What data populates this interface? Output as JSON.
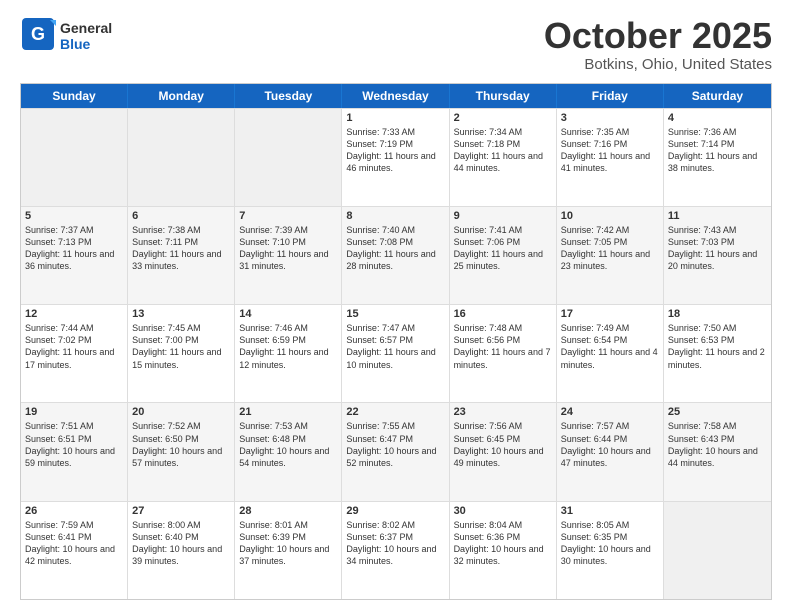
{
  "header": {
    "logo_general": "General",
    "logo_blue": "Blue",
    "month_title": "October 2025",
    "location": "Botkins, Ohio, United States"
  },
  "days_of_week": [
    "Sunday",
    "Monday",
    "Tuesday",
    "Wednesday",
    "Thursday",
    "Friday",
    "Saturday"
  ],
  "weeks": [
    [
      {
        "day": "",
        "info": ""
      },
      {
        "day": "",
        "info": ""
      },
      {
        "day": "",
        "info": ""
      },
      {
        "day": "1",
        "info": "Sunrise: 7:33 AM\nSunset: 7:19 PM\nDaylight: 11 hours\nand 46 minutes."
      },
      {
        "day": "2",
        "info": "Sunrise: 7:34 AM\nSunset: 7:18 PM\nDaylight: 11 hours\nand 44 minutes."
      },
      {
        "day": "3",
        "info": "Sunrise: 7:35 AM\nSunset: 7:16 PM\nDaylight: 11 hours\nand 41 minutes."
      },
      {
        "day": "4",
        "info": "Sunrise: 7:36 AM\nSunset: 7:14 PM\nDaylight: 11 hours\nand 38 minutes."
      }
    ],
    [
      {
        "day": "5",
        "info": "Sunrise: 7:37 AM\nSunset: 7:13 PM\nDaylight: 11 hours\nand 36 minutes."
      },
      {
        "day": "6",
        "info": "Sunrise: 7:38 AM\nSunset: 7:11 PM\nDaylight: 11 hours\nand 33 minutes."
      },
      {
        "day": "7",
        "info": "Sunrise: 7:39 AM\nSunset: 7:10 PM\nDaylight: 11 hours\nand 31 minutes."
      },
      {
        "day": "8",
        "info": "Sunrise: 7:40 AM\nSunset: 7:08 PM\nDaylight: 11 hours\nand 28 minutes."
      },
      {
        "day": "9",
        "info": "Sunrise: 7:41 AM\nSunset: 7:06 PM\nDaylight: 11 hours\nand 25 minutes."
      },
      {
        "day": "10",
        "info": "Sunrise: 7:42 AM\nSunset: 7:05 PM\nDaylight: 11 hours\nand 23 minutes."
      },
      {
        "day": "11",
        "info": "Sunrise: 7:43 AM\nSunset: 7:03 PM\nDaylight: 11 hours\nand 20 minutes."
      }
    ],
    [
      {
        "day": "12",
        "info": "Sunrise: 7:44 AM\nSunset: 7:02 PM\nDaylight: 11 hours\nand 17 minutes."
      },
      {
        "day": "13",
        "info": "Sunrise: 7:45 AM\nSunset: 7:00 PM\nDaylight: 11 hours\nand 15 minutes."
      },
      {
        "day": "14",
        "info": "Sunrise: 7:46 AM\nSunset: 6:59 PM\nDaylight: 11 hours\nand 12 minutes."
      },
      {
        "day": "15",
        "info": "Sunrise: 7:47 AM\nSunset: 6:57 PM\nDaylight: 11 hours\nand 10 minutes."
      },
      {
        "day": "16",
        "info": "Sunrise: 7:48 AM\nSunset: 6:56 PM\nDaylight: 11 hours\nand 7 minutes."
      },
      {
        "day": "17",
        "info": "Sunrise: 7:49 AM\nSunset: 6:54 PM\nDaylight: 11 hours\nand 4 minutes."
      },
      {
        "day": "18",
        "info": "Sunrise: 7:50 AM\nSunset: 6:53 PM\nDaylight: 11 hours\nand 2 minutes."
      }
    ],
    [
      {
        "day": "19",
        "info": "Sunrise: 7:51 AM\nSunset: 6:51 PM\nDaylight: 10 hours\nand 59 minutes."
      },
      {
        "day": "20",
        "info": "Sunrise: 7:52 AM\nSunset: 6:50 PM\nDaylight: 10 hours\nand 57 minutes."
      },
      {
        "day": "21",
        "info": "Sunrise: 7:53 AM\nSunset: 6:48 PM\nDaylight: 10 hours\nand 54 minutes."
      },
      {
        "day": "22",
        "info": "Sunrise: 7:55 AM\nSunset: 6:47 PM\nDaylight: 10 hours\nand 52 minutes."
      },
      {
        "day": "23",
        "info": "Sunrise: 7:56 AM\nSunset: 6:45 PM\nDaylight: 10 hours\nand 49 minutes."
      },
      {
        "day": "24",
        "info": "Sunrise: 7:57 AM\nSunset: 6:44 PM\nDaylight: 10 hours\nand 47 minutes."
      },
      {
        "day": "25",
        "info": "Sunrise: 7:58 AM\nSunset: 6:43 PM\nDaylight: 10 hours\nand 44 minutes."
      }
    ],
    [
      {
        "day": "26",
        "info": "Sunrise: 7:59 AM\nSunset: 6:41 PM\nDaylight: 10 hours\nand 42 minutes."
      },
      {
        "day": "27",
        "info": "Sunrise: 8:00 AM\nSunset: 6:40 PM\nDaylight: 10 hours\nand 39 minutes."
      },
      {
        "day": "28",
        "info": "Sunrise: 8:01 AM\nSunset: 6:39 PM\nDaylight: 10 hours\nand 37 minutes."
      },
      {
        "day": "29",
        "info": "Sunrise: 8:02 AM\nSunset: 6:37 PM\nDaylight: 10 hours\nand 34 minutes."
      },
      {
        "day": "30",
        "info": "Sunrise: 8:04 AM\nSunset: 6:36 PM\nDaylight: 10 hours\nand 32 minutes."
      },
      {
        "day": "31",
        "info": "Sunrise: 8:05 AM\nSunset: 6:35 PM\nDaylight: 10 hours\nand 30 minutes."
      },
      {
        "day": "",
        "info": ""
      }
    ]
  ]
}
